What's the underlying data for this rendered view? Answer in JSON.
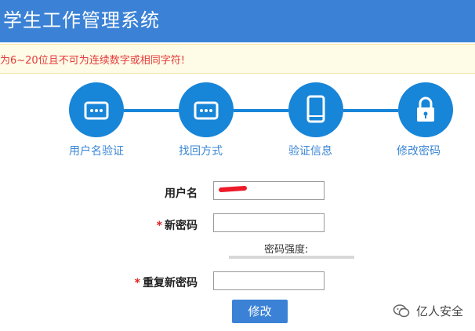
{
  "header": {
    "title": "学生工作管理系统"
  },
  "notice": {
    "text": "为6~20位且不可为连续数字或相同字符!"
  },
  "steps": [
    {
      "label": "用户名验证",
      "icon": "dots-icon"
    },
    {
      "label": "找回方式",
      "icon": "dots-icon"
    },
    {
      "label": "验证信息",
      "icon": "phone-icon"
    },
    {
      "label": "修改密码",
      "icon": "lock-icon"
    }
  ],
  "form": {
    "username_label": "用户名",
    "new_password_label": "新密码",
    "strength_label": "密码强度:",
    "repeat_password_label": "重复新密码",
    "required_mark": "*",
    "submit_label": "修改"
  },
  "watermark": {
    "text": "亿人安全"
  },
  "colors": {
    "header": "#3b82d6",
    "step": "#1785d8",
    "notice_text": "#e43b3b"
  }
}
